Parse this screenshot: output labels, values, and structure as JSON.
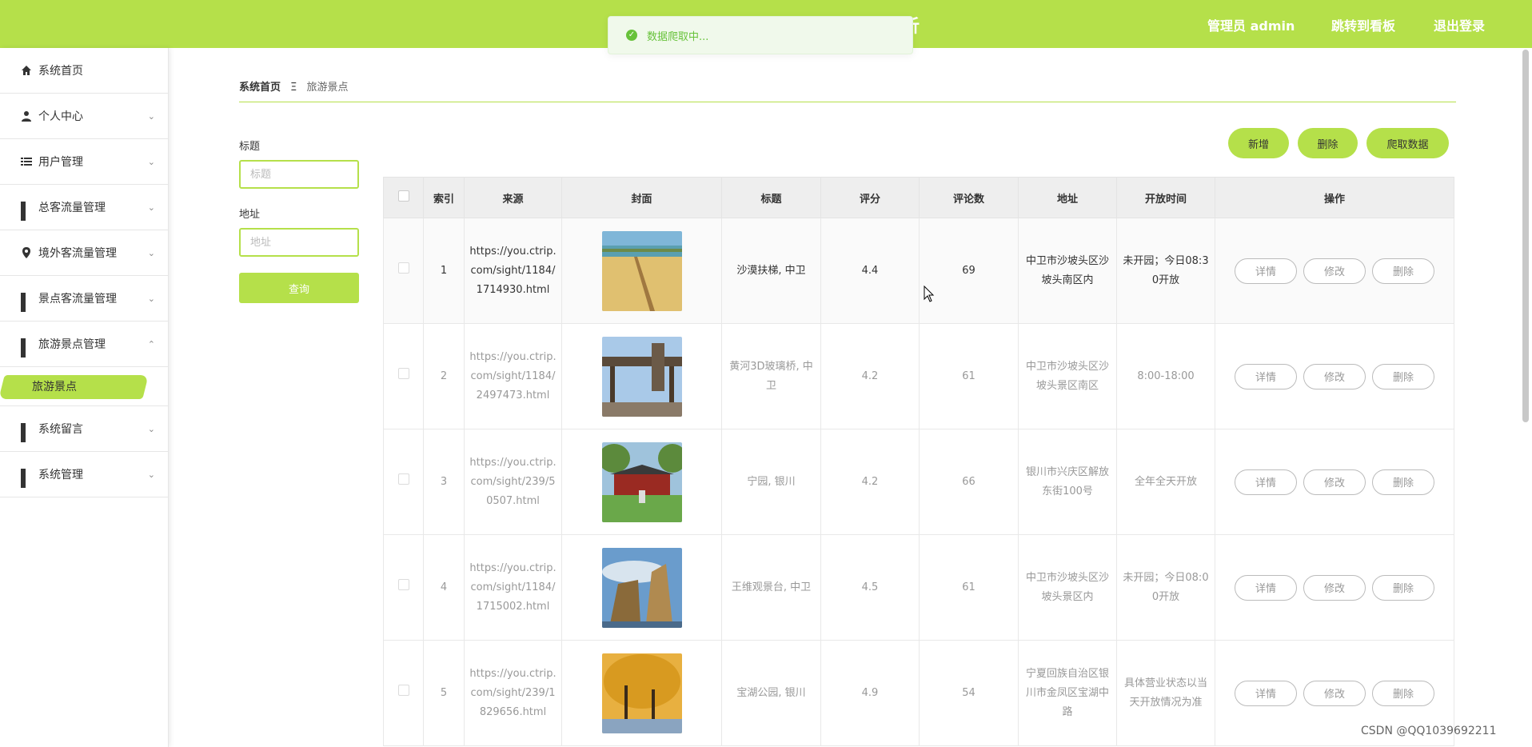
{
  "header": {
    "title_fragment": "析",
    "admin_label": "管理员 admin",
    "dashboard_link": "跳转到看板",
    "logout_link": "退出登录",
    "accent_color": "#b5e04a"
  },
  "toast": {
    "message": "数据爬取中...",
    "icon": "success-check-icon",
    "color": "#67c23a"
  },
  "sidebar": {
    "items": [
      {
        "label": "系统首页",
        "icon": "home-icon"
      },
      {
        "label": "个人中心",
        "icon": "user-icon"
      },
      {
        "label": "用户管理",
        "icon": "list-icon"
      },
      {
        "label": "总客流量管理",
        "icon": "grid-icon"
      },
      {
        "label": "境外客流量管理",
        "icon": "location-pin-icon"
      },
      {
        "label": "景点客流量管理",
        "icon": "grid-icon"
      },
      {
        "label": "旅游景点管理",
        "icon": "grid-icon",
        "expanded": true
      },
      {
        "label": "系统留言",
        "icon": "grid-icon"
      },
      {
        "label": "系统管理",
        "icon": "grid-icon"
      }
    ],
    "sub_items": [
      {
        "label": "旅游景点",
        "active": true
      }
    ]
  },
  "breadcrumb": {
    "home": "系统首页",
    "separator": "Ξ",
    "current": "旅游景点"
  },
  "search": {
    "title_label": "标题",
    "title_placeholder": "标题",
    "address_label": "地址",
    "address_placeholder": "地址",
    "query_button": "查询"
  },
  "actions": {
    "add": "新增",
    "delete": "删除",
    "crawl": "爬取数据"
  },
  "table": {
    "columns": [
      "索引",
      "来源",
      "封面",
      "标题",
      "评分",
      "评论数",
      "地址",
      "开放时间",
      "操作"
    ],
    "row_buttons": {
      "detail": "详情",
      "edit": "修改",
      "delete": "删除"
    },
    "rows": [
      {
        "index": "1",
        "source": "https://you.ctrip.com/sight/1184/1714930.html",
        "cover": "desert-slide-photo",
        "title": "沙漠扶梯, 中卫",
        "rating": "4.4",
        "comments": "69",
        "address": "中卫市沙坡头区沙坡头南区内",
        "hours": "未开园；今日08:30开放"
      },
      {
        "index": "2",
        "source": "https://you.ctrip.com/sight/1184/2497473.html",
        "cover": "yellow-river-bridge-photo",
        "title": "黄河3D玻璃桥, 中卫",
        "rating": "4.2",
        "comments": "61",
        "address": "中卫市沙坡头区沙坡头景区南区",
        "hours": "8:00-18:00"
      },
      {
        "index": "3",
        "source": "https://you.ctrip.com/sight/239/50507.html",
        "cover": "ning-garden-photo",
        "title": "宁园, 银川",
        "rating": "4.2",
        "comments": "66",
        "address": "银川市兴庆区解放东街100号",
        "hours": "全年全天开放"
      },
      {
        "index": "4",
        "source": "https://you.ctrip.com/sight/1184/1715002.html",
        "cover": "rock-viewpoint-photo",
        "title": "王维观景台, 中卫",
        "rating": "4.5",
        "comments": "61",
        "address": "中卫市沙坡头区沙坡头景区内",
        "hours": "未开园；今日08:00开放"
      },
      {
        "index": "5",
        "source": "https://you.ctrip.com/sight/239/1829656.html",
        "cover": "baohu-park-photo",
        "title": "宝湖公园, 银川",
        "rating": "4.9",
        "comments": "54",
        "address": "宁夏回族自治区银川市金凤区宝湖中路",
        "hours": "具体营业状态以当天开放情况为准"
      }
    ]
  },
  "watermark": "CSDN @QQ1039692211"
}
